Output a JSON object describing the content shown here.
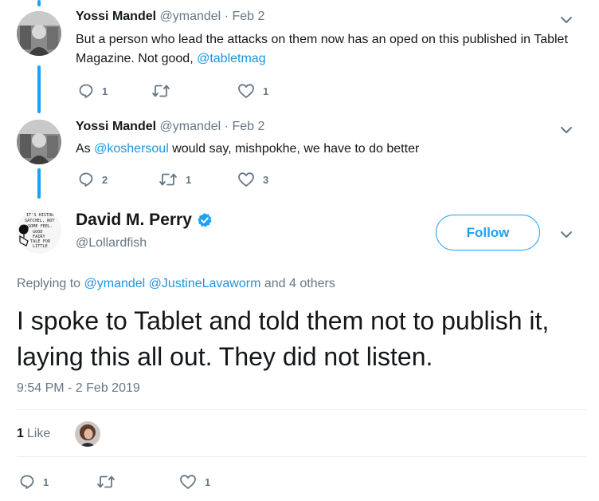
{
  "thread": [
    {
      "name": "Yossi Mandel",
      "handle_time": "@ymandel · Feb 2",
      "text_parts": [
        {
          "text": "But a person who lead the attacks on them now has an oped on this published in Tablet Magazine. Not good, ",
          "mention": false
        },
        {
          "text": "@tabletmag",
          "mention": true
        }
      ],
      "reply_count": "1",
      "retweet_count": "",
      "like_count": "1"
    },
    {
      "name": "Yossi Mandel",
      "handle_time": "@ymandel · Feb 2",
      "text_parts": [
        {
          "text": "As ",
          "mention": false
        },
        {
          "text": "@koshersoul",
          "mention": true
        },
        {
          "text": " would say, mishpokhe, we have to do better",
          "mention": false
        }
      ],
      "reply_count": "2",
      "retweet_count": "1",
      "like_count": "3"
    }
  ],
  "main_tweet": {
    "name": "David M. Perry",
    "verified": true,
    "handle": "@Lollardfish",
    "follow_label": "Follow",
    "replying_label": "Replying to ",
    "replying_mentions": [
      "@ymandel",
      "@JustineLavaworm"
    ],
    "replying_suffix": " and 4 others",
    "text": "I spoke to Tablet and told them not to publish it, laying this all out. They did not listen.",
    "timestamp": "9:54 PM - 2 Feb 2019",
    "like_total": "1",
    "like_label": "Like",
    "reply_count": "1",
    "retweet_count": "",
    "like_count": "1"
  },
  "avatar_sign_text": [
    "IT'S HISTOR",
    "SATCHEL, NOT",
    "SOME FEEL-",
    "GOOD",
    "FAIRY",
    "TALE FOR",
    "LITTLE"
  ],
  "colors": {
    "accent": "#1da1f2",
    "mention": "#1b95e0",
    "muted": "#657786",
    "text": "#14171a",
    "divider": "#e6ecf0"
  },
  "icons": [
    "reply-icon",
    "retweet-icon",
    "like-icon",
    "chevron-down-icon",
    "verified-badge-icon"
  ]
}
